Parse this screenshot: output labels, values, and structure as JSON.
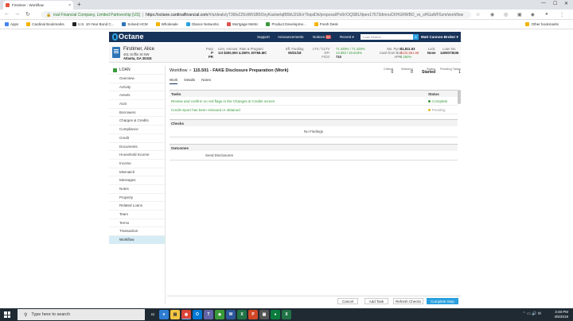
{
  "browser": {
    "tab_title": "Firstimer - Workflow",
    "new_tab": "+",
    "win_min": "—",
    "win_max": "☐",
    "win_close": "✕",
    "site_label": "inal Financial Company, Limited Partnership [US]",
    "host": "https://octane.cardinalfinancial.com",
    "url_rest": "/#/a/deals/yT3t9vZZ6xWhSB5OoyKastwrtqlB5bU2UErrTkqstDk/proposal/Po0r/OQSBLNpeo17673dmnuCKHGRWBO_vx_sHGaWF5zm/workflow",
    "bookmarks": [
      "Apps",
      "Cardinal Bookmarks",
      "U.S. 10-Year Bond C...",
      "Solved HCM",
      "Wholesale",
      "Glance Networks",
      "Mortgage Metric",
      "Product Developme...",
      "Fresh Desk"
    ],
    "other_bookmarks": "Other bookmarks",
    "colors": {
      "apps": "#4285f4",
      "cardinal": "#f4b400",
      "bond": "#222222",
      "solved": "#2e75b6",
      "wholesale": "#f4b400",
      "glance": "#2aa0df",
      "mortgage": "#d9534f",
      "product": "#3a9a3a",
      "fresh": "#f4b400"
    }
  },
  "header": {
    "logo": "Octane",
    "support": "Support",
    "announcements": "Announcements",
    "notices": "Notices",
    "notices_count": "50",
    "recent": "Recent ▾",
    "search_placeholder": "Loan Search",
    "user": "Matt Cannon-Broker ▾"
  },
  "banner": {
    "name": "Firstimer, Alice",
    "address1": "461 Griffin St NW",
    "address2": "Atlanta, GA 30318",
    "purp_label": "Purp",
    "purp_lines": [
      "P",
      "PR"
    ],
    "loan_title": "Lien, Amount, Rate & Program",
    "loan_line": "1st  $300,000  4.250%  30YMLMC",
    "eff_label": "Eff. Funding",
    "eff_date": "05/31/18",
    "ltv_label": "LTV / CLTV",
    "ltv_value": "71.428% / 71.428%",
    "dti_label": "DTI",
    "dti_value": "14.993 / 20.818%",
    "fico_label": "FICO",
    "fico_value": "710",
    "pymt_label": "Mo. Pymt",
    "pymt_value": "$1,811.93",
    "cash_label": "Cash from Bor",
    "cash_value": "$132,551.69",
    "apr_label": "APR",
    "apr_value": "4.250%",
    "lock_label": "Lock",
    "lock_value": "None",
    "loanno_label": "Loan No.",
    "loanno_value": "1400073636"
  },
  "sidebar": {
    "section": "LOAN",
    "items": [
      "Overview",
      "Activity",
      "Assets",
      "AUS",
      "Borrowers",
      "Charges & Credits",
      "Compliance",
      "Credit",
      "Documents",
      "Household Income",
      "Income",
      "Mismatch",
      "Messages",
      "Notes",
      "Property",
      "Related Loans",
      "Team",
      "Terms",
      "Transaction",
      "Workflow"
    ]
  },
  "main": {
    "crumb_root": "Workflow",
    "crumb_sep": ">",
    "title": "115.501 - FAKE Disclosure Preparation (Work)",
    "critical_label": "Critical",
    "critical_value": "0",
    "warning_label": "Warning",
    "warning_value": "0",
    "status_label": "Status",
    "status_value": "Started",
    "pending_label": "Pending Tasks",
    "pending_value": "1",
    "tabs": [
      "Work",
      "Details",
      "Notes"
    ],
    "tasks_header": "Tasks",
    "status_header": "Status",
    "tasks": [
      {
        "label": "Review and confirm no red flags in the Changes & Credits screen",
        "status": "Complete",
        "color": "#3a9a3a"
      },
      {
        "label": "Credit report has been reissued or obtained",
        "status": "Pending",
        "color": "#e6b422"
      }
    ],
    "checks_header": "Checks",
    "no_findings": "No Findings",
    "outcomes_header": "Outcomes",
    "outcome": "Send Disclosures"
  },
  "footer": {
    "cancel": "Cancel",
    "add_task": "Add Task",
    "refresh": "Refresh Checks",
    "complete": "Complete Step"
  },
  "taskbar": {
    "search": "Type here to search",
    "time": "3:48 PM",
    "date": "4/5/2019"
  }
}
